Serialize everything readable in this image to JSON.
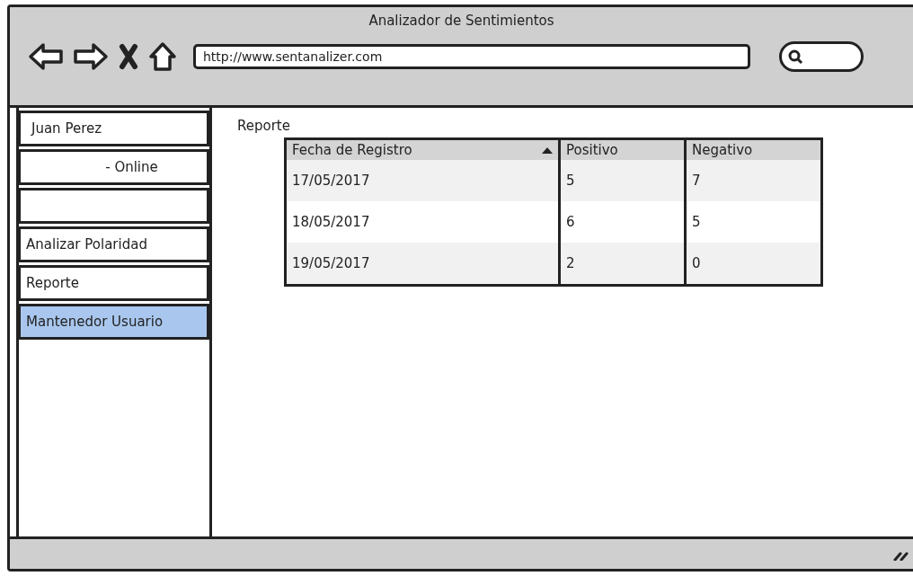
{
  "window": {
    "title": "Analizador de Sentimientos"
  },
  "toolbar": {
    "url": "http://www.sentanalizer.com"
  },
  "sidebar": {
    "items": [
      {
        "kind": "user",
        "label": "Juan Perez",
        "selected": false
      },
      {
        "kind": "status",
        "label": "- Online",
        "selected": false
      },
      {
        "kind": "blank",
        "selected": false
      },
      {
        "kind": "link",
        "label": "Analizar Polaridad",
        "selected": false
      },
      {
        "kind": "link",
        "label": "Reporte",
        "selected": false
      },
      {
        "kind": "link",
        "label": "Mantenedor Usuario",
        "selected": true
      }
    ]
  },
  "content": {
    "heading": "Reporte",
    "table": {
      "columns": [
        {
          "label": "Fecha de Registro",
          "sorted": true
        },
        {
          "label": "Positivo",
          "sorted": false
        },
        {
          "label": "Negativo",
          "sorted": false
        }
      ],
      "rows": [
        [
          "17/05/2017",
          "5",
          "7"
        ],
        [
          "18/05/2017",
          "6",
          "5"
        ],
        [
          "19/05/2017",
          "2",
          "0"
        ]
      ]
    }
  }
}
